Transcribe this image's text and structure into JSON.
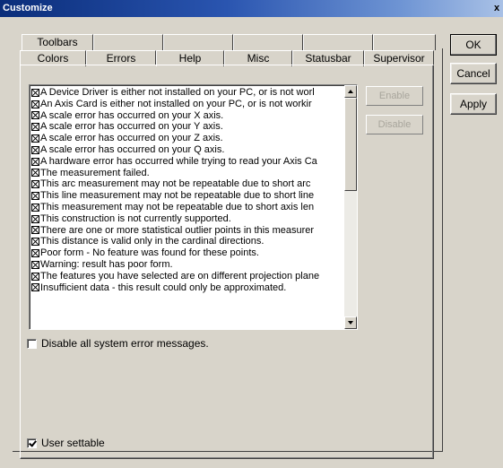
{
  "window": {
    "title": "Customize",
    "close_glyph": "x"
  },
  "buttons": {
    "ok": "OK",
    "cancel": "Cancel",
    "apply": "Apply"
  },
  "tabs": {
    "back_row": [
      "Toolbars",
      "",
      "",
      "",
      "",
      ""
    ],
    "front_row": [
      "Colors",
      "Errors",
      "Help",
      "Misc",
      "Statusbar",
      "Supervisor"
    ],
    "active": "Errors"
  },
  "errors": {
    "items": [
      "A Device Driver is either not installed on your PC, or is not worl",
      "An Axis Card is either not installed on your PC, or is not workir",
      "A scale error has occurred on your X axis.",
      "A scale error has occurred on your Y axis.",
      "A scale error has occurred on your Z axis.",
      "A scale error has occurred on your Q axis.",
      "A hardware error has occurred while trying to read your Axis Ca",
      "The measurement failed.",
      "This arc measurement may not be repeatable due to short arc",
      "This line measurement may not be repeatable due to short line",
      "This measurement may not be repeatable due to short axis len",
      "This construction is not currently supported.",
      "There are one or more statistical outlier points in this measurer",
      "This distance is valid only in the cardinal directions.",
      "Poor form - No feature was found for these points.",
      "Warning: result has poor form.",
      "The features you have selected are on different projection plane",
      "Insufficient data - this result could only be approximated."
    ],
    "enable_label": "Enable",
    "disable_label": "Disable",
    "disable_all_label": "Disable all system error messages.",
    "user_settable_label": "User settable",
    "user_settable_checked": true,
    "disable_all_checked": false
  },
  "icons": {
    "item_check": "checkbox-x-icon",
    "scroll_up": "arrow-up-icon",
    "scroll_down": "arrow-down-icon"
  },
  "colors": {
    "titlebar_start": "#0a2d7a",
    "titlebar_end": "#a9c1e6",
    "face": "#d8d4ca"
  }
}
